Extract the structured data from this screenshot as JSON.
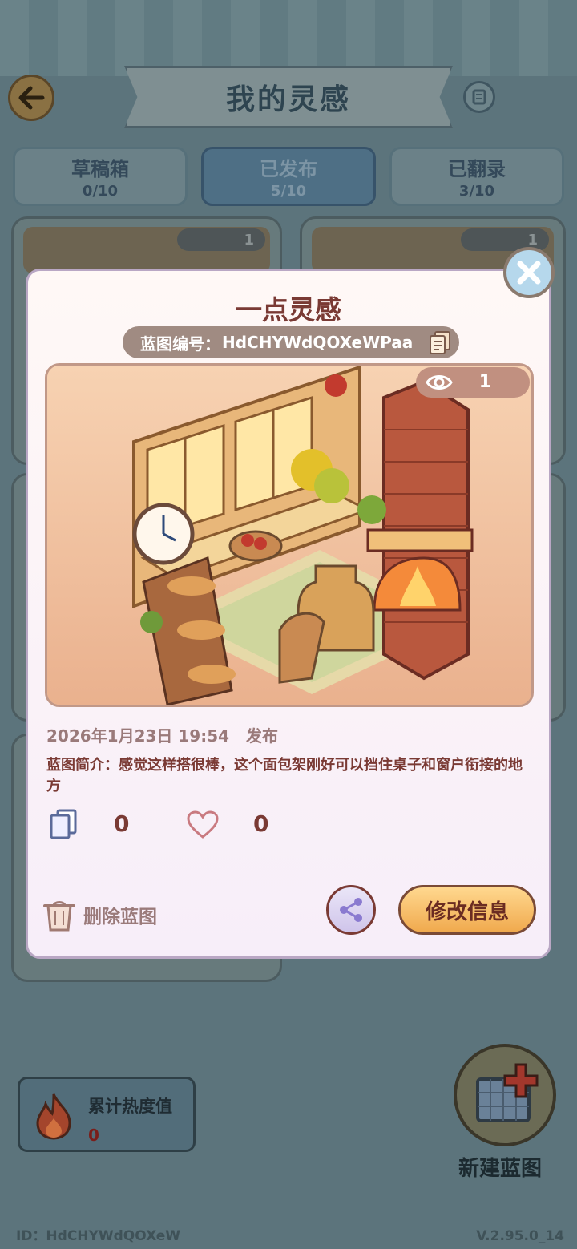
{
  "header": {
    "title": "我的灵感"
  },
  "tabs": [
    {
      "label": "草稿箱",
      "count": "0/10"
    },
    {
      "label": "已发布",
      "count": "5/10"
    },
    {
      "label": "已翻录",
      "count": "3/10"
    }
  ],
  "background_cards": [
    {
      "views": "1"
    },
    {
      "views": "1"
    }
  ],
  "heat": {
    "label": "累计热度值",
    "value": "0"
  },
  "new_blueprint": {
    "label": "新建蓝图"
  },
  "footer": {
    "id": "ID：HdCHYWdQOXeW",
    "version": "V.2.95.0_14"
  },
  "modal": {
    "title": "一点灵感",
    "blueprint_label": "蓝图编号：",
    "blueprint_code": "HdCHYWdQOXeWPaa",
    "views": "1",
    "date": "2026年1月23日 19:54",
    "status": "发布",
    "description": "蓝图简介：感觉这样搭很棒，这个面包架刚好可以挡住桌子和窗户衔接的地方",
    "copies": "0",
    "likes": "0",
    "delete_label": "删除蓝图",
    "edit_label": "修改信息"
  },
  "colors": {
    "accent_text": "#7a3a34",
    "button_gold": "#f0a94d",
    "overlay_bg": "#5c747c"
  }
}
